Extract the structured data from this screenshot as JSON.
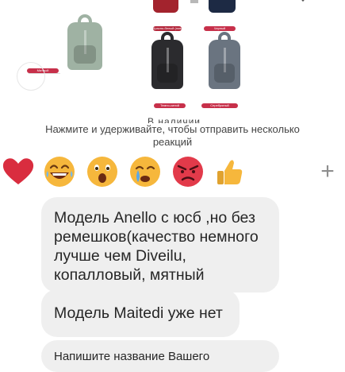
{
  "product_image": {
    "color_tags": [
      "Красно-белый (новый)",
      "Черный",
      "Мятный",
      "Темно-синий",
      "Серебряный"
    ]
  },
  "reaction_prompt": {
    "partial_heading": "В наличии",
    "text": "Нажмите и удерживайте, чтобы отправить несколько реакций"
  },
  "reactions": {
    "items": [
      {
        "name": "heart",
        "color": "#d92d3f"
      },
      {
        "name": "laughing",
        "color": "#f6b73c"
      },
      {
        "name": "surprised",
        "color": "#f6b73c"
      },
      {
        "name": "crying",
        "color": "#f6b73c"
      },
      {
        "name": "angry",
        "color": "#e23a4a"
      },
      {
        "name": "thumbs-up",
        "color": "#f6b73c"
      }
    ],
    "add_symbol": "+"
  },
  "messages": [
    {
      "text": "Модель Anello c юсб ,но без ремешков(качество немного лучше чем Diveilu, копалловый, мятный"
    },
    {
      "text": "Модель Maitedi уже нет"
    },
    {
      "text": "Напишите название Вашего"
    }
  ]
}
